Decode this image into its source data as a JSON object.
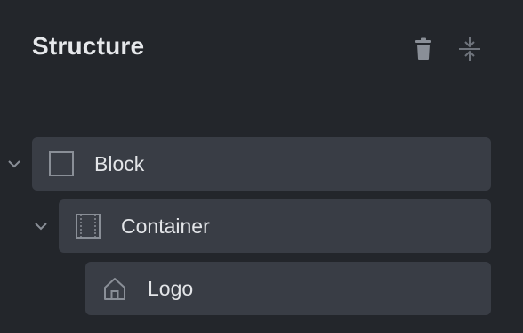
{
  "panel": {
    "title": "Structure"
  },
  "toolbar": {
    "delete_icon": "trash-icon",
    "collapse_icon": "collapse-vertical-icon"
  },
  "tree": {
    "items": [
      {
        "label": "Block",
        "icon": "block-square-icon",
        "expanded": true,
        "depth": 0
      },
      {
        "label": "Container",
        "icon": "container-icon",
        "expanded": true,
        "depth": 1
      },
      {
        "label": "Logo",
        "icon": "home-icon",
        "depth": 2
      }
    ]
  },
  "colors": {
    "background": "#23262b",
    "row": "#393d45",
    "text": "#e3e5e8",
    "icon": "#8a8f97"
  }
}
